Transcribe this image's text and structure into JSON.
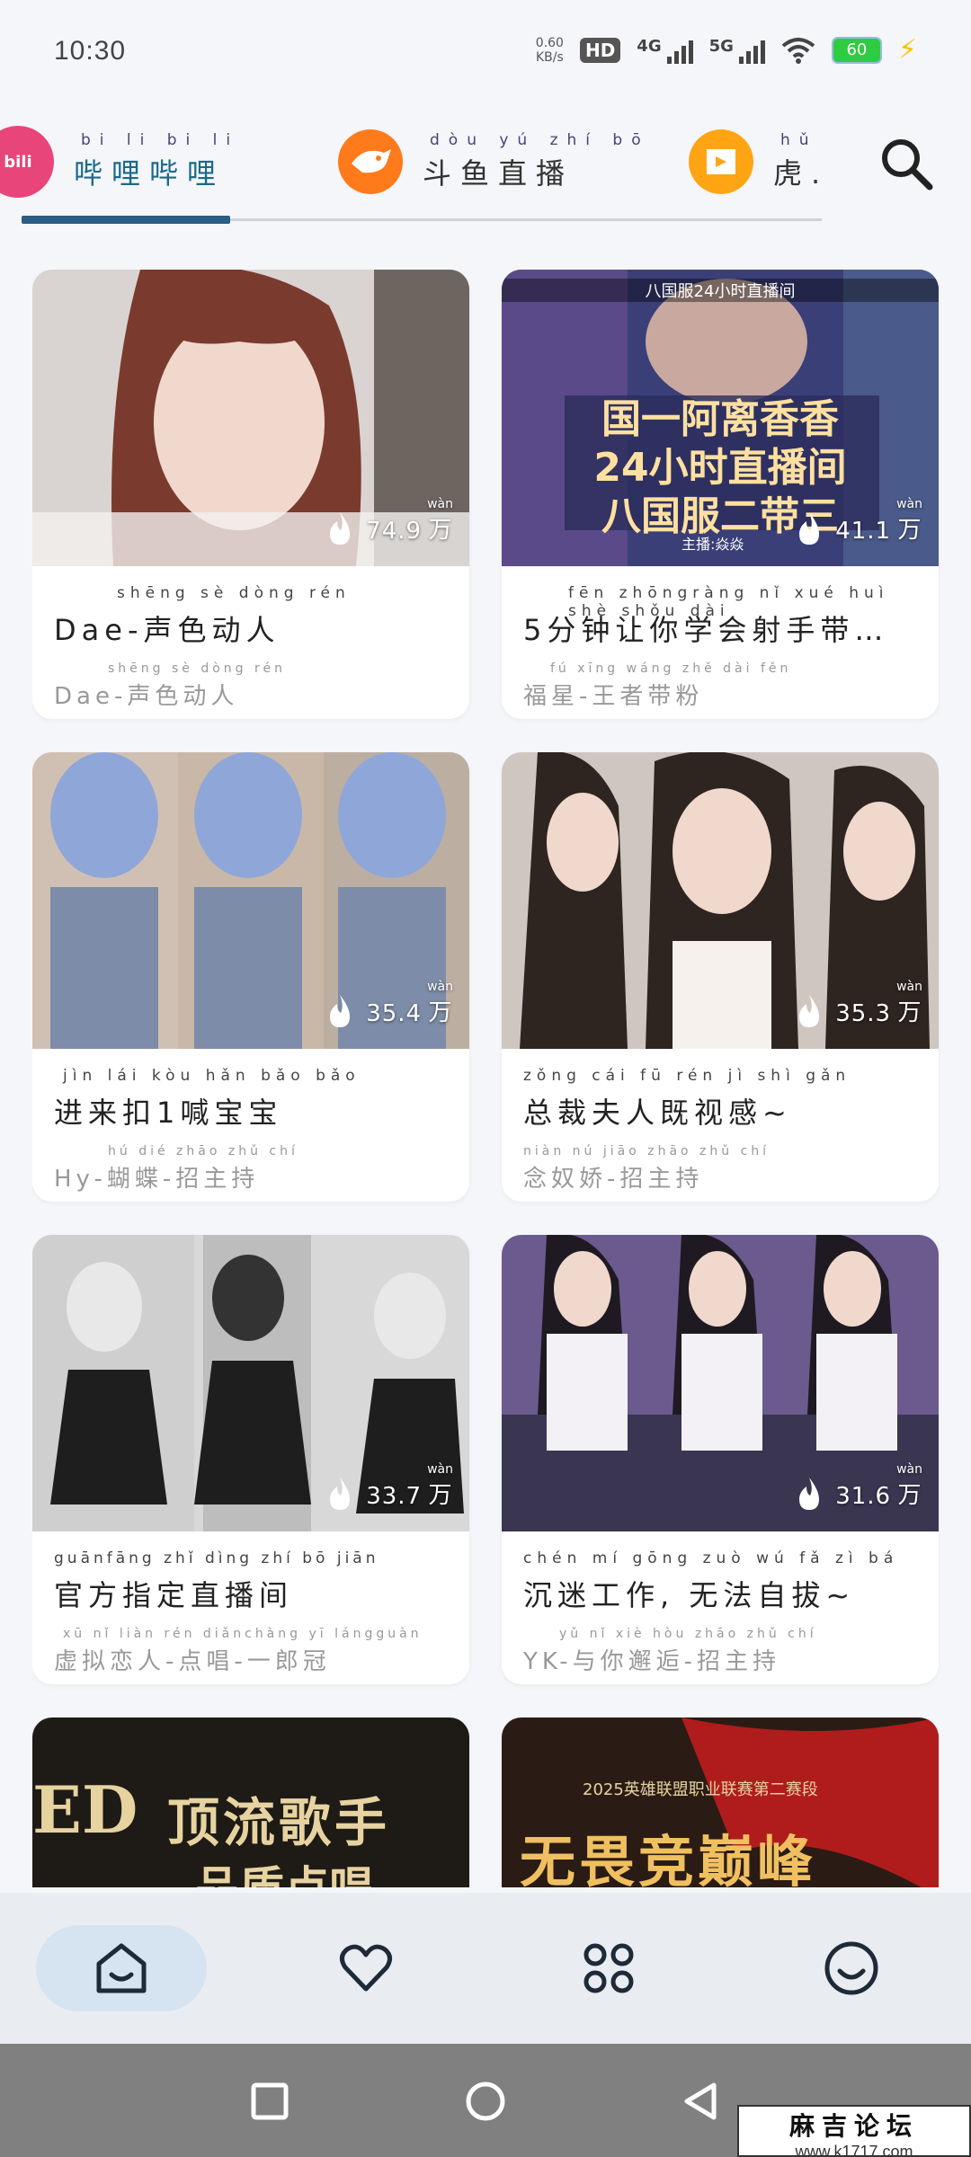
{
  "status": {
    "time": "10:30",
    "net_speed": "0.60",
    "net_unit": "KB/s",
    "hd": "HD",
    "sig1": "4G",
    "sig2": "5G",
    "battery": "60"
  },
  "tabs": [
    {
      "logo": "bili",
      "pinyin": "bi li bi li",
      "label": "哔哩哔哩",
      "color": "#e8457a"
    },
    {
      "logo": "douyu",
      "pinyin": "dòu yú zhí bō",
      "label": "斗鱼直播",
      "color": "#ff7a1a"
    },
    {
      "logo": "huya",
      "pinyin": "hǔ",
      "label": "虎.",
      "color": "#ffa514"
    }
  ],
  "cards": [
    {
      "hot": "74.9",
      "unit_py": "wàn",
      "unit": "万",
      "title_py": "shēng sè dòng rén",
      "title": "Dae-声色动人",
      "sub_py": "shēng sè dòng rén",
      "sub": "Dae-声色动人"
    },
    {
      "hot": "41.1",
      "unit_py": "wàn",
      "unit": "万",
      "title_py": "fēn zhōngràng nǐ xué huì shè shǒu dài",
      "title": "5分钟让你学会射手带…",
      "sub_py": "fú xīng wáng zhě dài fěn",
      "sub": "福星-王者带粉",
      "thumb_lines": [
        "八国服24小时直播间",
        "国一阿离香香",
        "24小时直播间",
        "八国服二带三",
        "主播:焱焱"
      ]
    },
    {
      "hot": "35.4",
      "unit_py": "wàn",
      "unit": "万",
      "title_py": "jìn lái kòu hǎn bǎo bǎo",
      "title": "进来扣1喊宝宝",
      "sub_py": "hú dié zhāo zhǔ chí",
      "sub": "Hy-蝴蝶-招主持"
    },
    {
      "hot": "35.3",
      "unit_py": "wàn",
      "unit": "万",
      "title_py": "zǒng cái fū rén jì shì gǎn",
      "title": "总裁夫人既视感~",
      "sub_py": "niàn nú jiāo zhāo zhǔ chí",
      "sub": "念奴娇-招主持"
    },
    {
      "hot": "33.7",
      "unit_py": "wàn",
      "unit": "万",
      "title_py": "guānfāng zhǐ dìng zhí bō jiān",
      "title": "官方指定直播间",
      "sub_py": "xū nǐ liàn rén diǎnchàng yī lángguàn",
      "sub": "虚拟恋人-点唱-一郎冠"
    },
    {
      "hot": "31.6",
      "unit_py": "wàn",
      "unit": "万",
      "title_py": "chén mí gōng zuò wú fǎ zì bá",
      "title": "沉迷工作, 无法自拔~",
      "sub_py": "yǔ nǐ xiè hòu zhāo zhǔ chí",
      "sub": "YK-与你邂逅-招主持"
    },
    {
      "thumb_lines": [
        "ED",
        "顶流歌手",
        "品质点唱"
      ]
    },
    {
      "thumb_lines": [
        "2025英雄联盟职业联赛第二赛段",
        "无畏竞巅峰"
      ]
    }
  ],
  "bottom_nav": [
    {
      "name": "home-icon",
      "active": true
    },
    {
      "name": "heart-icon",
      "active": false
    },
    {
      "name": "apps-icon",
      "active": false
    },
    {
      "name": "smile-icon",
      "active": false
    }
  ],
  "watermark": {
    "line1": "麻吉论坛",
    "line2": "www.k1717.com"
  }
}
